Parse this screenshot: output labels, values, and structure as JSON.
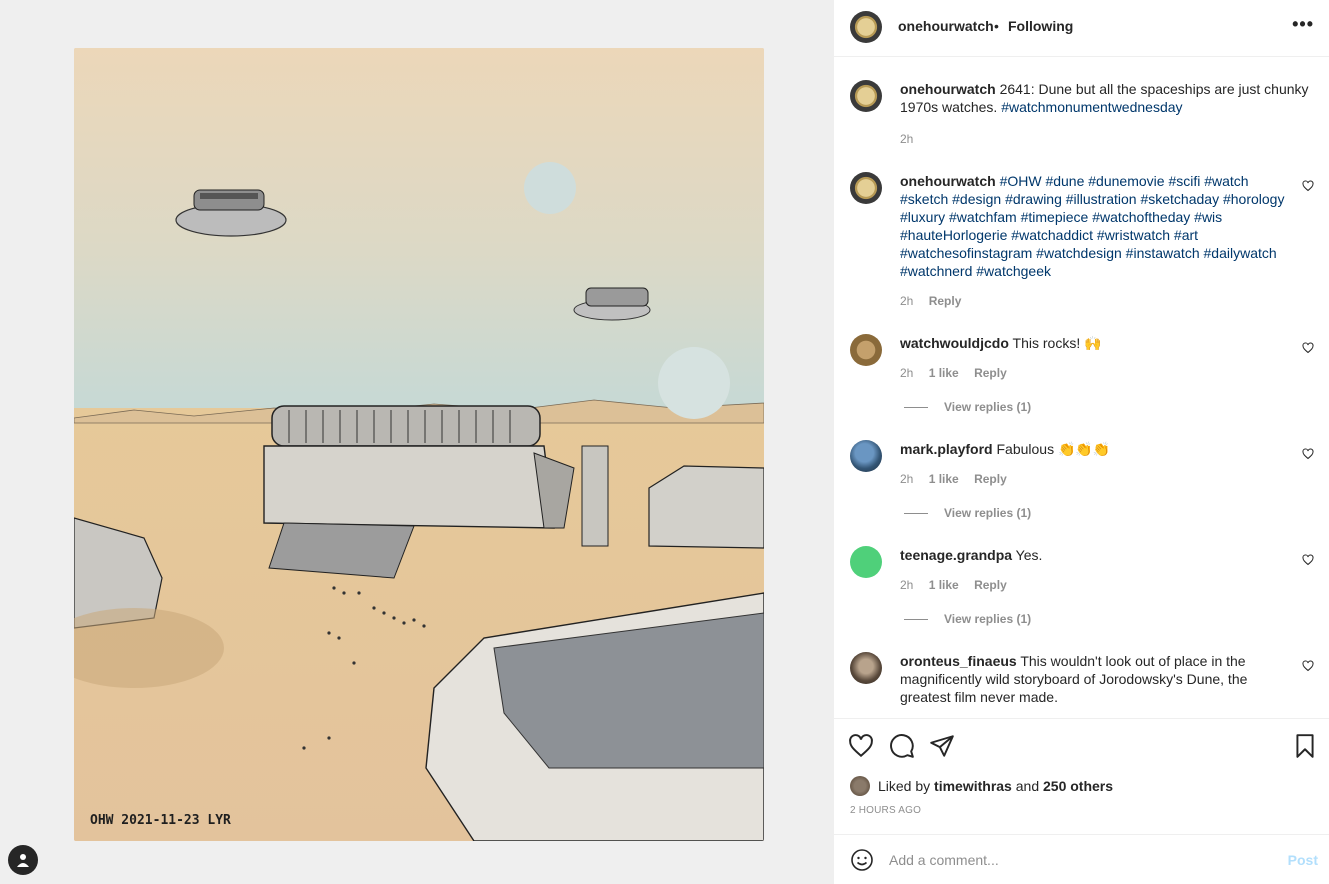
{
  "post": {
    "username": "onehourwatch",
    "follow_status": "Following",
    "separator": "•",
    "more_icon": "more-horizontal-icon",
    "image_signature": "OHW 2021-11-23 LYR"
  },
  "caption": {
    "username": "onehourwatch",
    "text": "2641: Dune but all the spaceships are just chunky 1970s watches.",
    "hashtag": "#watchmonumentwednesday",
    "time": "2h"
  },
  "comments": [
    {
      "username": "onehourwatch",
      "text": "",
      "hashtags": "#OHW #dune #dunemovie #scifi #watch #sketch #design #drawing #illustration #sketchaday #horology #luxury #watchfam #timepiece #watchoftheday #wis #hauteHorlogerie #watchaddict #wristwatch #art #watchesofinstagram #watchdesign #instawatch #dailywatch #watchnerd #watchgeek",
      "time": "2h",
      "likes": "",
      "reply": "Reply"
    },
    {
      "username": "watchwouldjcdo",
      "text": "This rocks! 🙌",
      "time": "2h",
      "likes": "1 like",
      "reply": "Reply",
      "view_replies": "View replies (1)"
    },
    {
      "username": "mark.playford",
      "text": "Fabulous 👏👏👏",
      "time": "2h",
      "likes": "1 like",
      "reply": "Reply",
      "view_replies": "View replies (1)"
    },
    {
      "username": "teenage.grandpa",
      "text": "Yes.",
      "time": "2h",
      "likes": "1 like",
      "reply": "Reply",
      "view_replies": "View replies (1)"
    },
    {
      "username": "oronteus_finaeus",
      "text": "This wouldn't look out of place in the magnificently wild storyboard of Jorodowsky's Dune, the greatest film never made."
    }
  ],
  "likes": {
    "prefix": "Liked by",
    "user": "timewithras",
    "conj": "and",
    "others": "250 others"
  },
  "time_ago": "2 HOURS AGO",
  "add_comment": {
    "placeholder": "Add a comment...",
    "post_label": "Post"
  },
  "colors": {
    "link": "#00376b",
    "muted": "#8e8e8e",
    "post_disabled": "#b2dffc"
  }
}
